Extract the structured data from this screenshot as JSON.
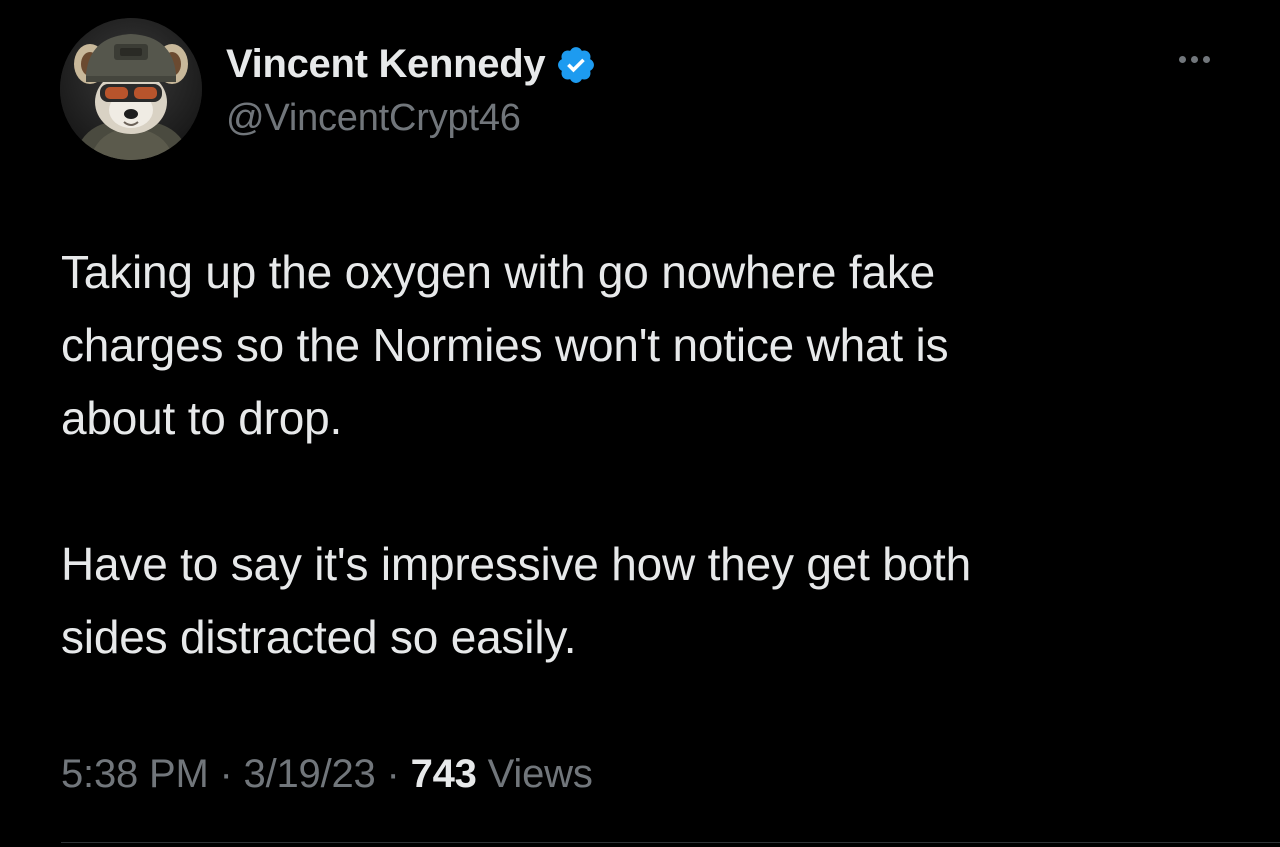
{
  "author": {
    "display_name": "Vincent Kennedy",
    "handle": "@VincentCrypt46",
    "verified": true,
    "verified_color": "#1d9bf0",
    "avatar_icon": "red-panda-soldier-avatar"
  },
  "tweet": {
    "paragraphs": [
      "Taking up the oxygen with go nowhere fake\ncharges so the Normies won't notice what is\nabout to drop.",
      "Have to say it's impressive how they get both\nsides distracted so easily."
    ],
    "time": "5:38 PM",
    "separator": "·",
    "date": "3/19/23",
    "views_count": "743",
    "views_label": "Views"
  },
  "colors": {
    "background": "#000000",
    "primary_text": "#e7e9ea",
    "secondary_text": "#71767b",
    "divider": "#2f3336"
  },
  "icons": {
    "more": "more-horizontal-icon",
    "verified": "verified-badge-icon"
  }
}
